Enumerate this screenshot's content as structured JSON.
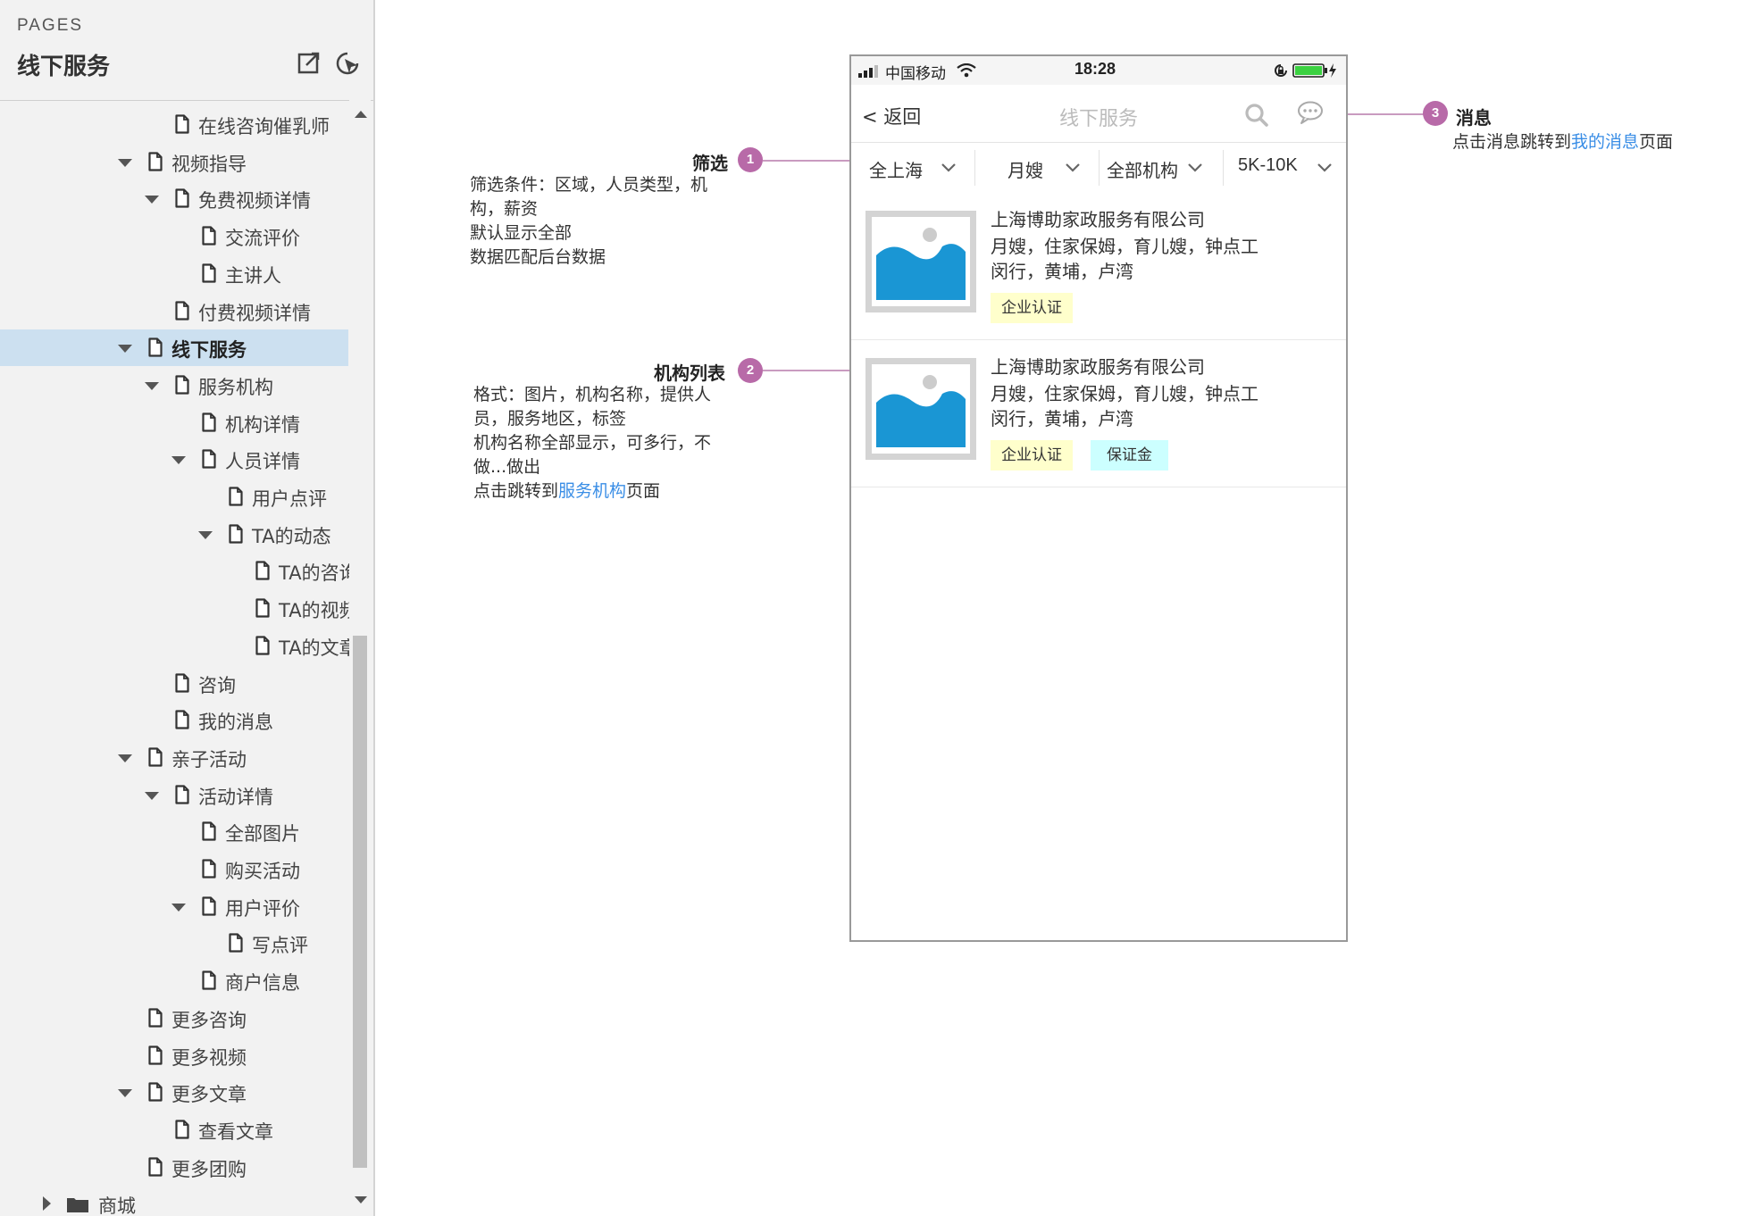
{
  "sidebar": {
    "header_label": "PAGES",
    "title": "线下服务",
    "tree": [
      {
        "label": "在线咨询催乳师",
        "level": 2,
        "toggle": "none",
        "icon": "page"
      },
      {
        "label": "视频指导",
        "level": 1,
        "toggle": "expanded",
        "icon": "page"
      },
      {
        "label": "免费视频详情",
        "level": 2,
        "toggle": "expanded",
        "icon": "page"
      },
      {
        "label": "交流评价",
        "level": 3,
        "toggle": "none",
        "icon": "page"
      },
      {
        "label": "主讲人",
        "level": 3,
        "toggle": "none",
        "icon": "page"
      },
      {
        "label": "付费视频详情",
        "level": 2,
        "toggle": "none",
        "icon": "page"
      },
      {
        "label": "线下服务",
        "level": 1,
        "toggle": "expanded",
        "icon": "page",
        "selected": true
      },
      {
        "label": "服务机构",
        "level": 2,
        "toggle": "expanded",
        "icon": "page"
      },
      {
        "label": "机构详情",
        "level": 3,
        "toggle": "none",
        "icon": "page"
      },
      {
        "label": "人员详情",
        "level": 3,
        "toggle": "expanded",
        "icon": "page"
      },
      {
        "label": "用户点评",
        "level": 4,
        "toggle": "none",
        "icon": "page"
      },
      {
        "label": "TA的动态",
        "level": 4,
        "toggle": "expanded",
        "icon": "page"
      },
      {
        "label": "TA的咨询",
        "level": 5,
        "toggle": "none",
        "icon": "page"
      },
      {
        "label": "TA的视频",
        "level": 5,
        "toggle": "none",
        "icon": "page"
      },
      {
        "label": "TA的文章",
        "level": 5,
        "toggle": "none",
        "icon": "page"
      },
      {
        "label": "咨询",
        "level": 2,
        "toggle": "none",
        "icon": "page"
      },
      {
        "label": "我的消息",
        "level": 2,
        "toggle": "none",
        "icon": "page"
      },
      {
        "label": "亲子活动",
        "level": 1,
        "toggle": "expanded",
        "icon": "page"
      },
      {
        "label": "活动详情",
        "level": 2,
        "toggle": "expanded",
        "icon": "page"
      },
      {
        "label": "全部图片",
        "level": 3,
        "toggle": "none",
        "icon": "page"
      },
      {
        "label": "购买活动",
        "level": 3,
        "toggle": "none",
        "icon": "page"
      },
      {
        "label": "用户评价",
        "level": 3,
        "toggle": "expanded",
        "icon": "page"
      },
      {
        "label": "写点评",
        "level": 4,
        "toggle": "none",
        "icon": "page"
      },
      {
        "label": "商户信息",
        "level": 3,
        "toggle": "none",
        "icon": "page"
      },
      {
        "label": "更多咨询",
        "level": 1,
        "toggle": "none",
        "icon": "page"
      },
      {
        "label": "更多视频",
        "level": 1,
        "toggle": "none",
        "icon": "page"
      },
      {
        "label": "更多文章",
        "level": 1,
        "toggle": "expanded",
        "icon": "page"
      },
      {
        "label": "查看文章",
        "level": 2,
        "toggle": "none",
        "icon": "page"
      },
      {
        "label": "更多团购",
        "level": 1,
        "toggle": "none",
        "icon": "page"
      },
      {
        "label": "商城",
        "level": 0,
        "toggle": "collapsed",
        "icon": "folder"
      }
    ]
  },
  "annotations": {
    "filter": {
      "number": "1",
      "title": "筛选",
      "lines": [
        "筛选条件：区域，人员类型，机",
        "构，薪资",
        "默认显示全部",
        "数据匹配后台数据"
      ]
    },
    "list": {
      "number": "2",
      "title": "机构列表",
      "lines": [
        "格式：图片，机构名称，提供人",
        "员，服务地区，标签",
        "机构名称全部显示，可多行，不",
        "做...做出"
      ],
      "link_prefix": "点击跳转到",
      "link_text": "服务机构",
      "link_suffix": "页面"
    },
    "message": {
      "number": "3",
      "title": "消息",
      "prefix": "点击消息跳转到",
      "link_text": "我的消息",
      "suffix": "页面"
    }
  },
  "phone": {
    "status": {
      "carrier": "中国移动",
      "time": "18:28"
    },
    "nav": {
      "back": "< 返回",
      "title": "线下服务"
    },
    "filters": [
      "全上海",
      "月嫂",
      "全部机构",
      "5K-10K"
    ],
    "items": [
      {
        "name": "上海博助家政服务有限公司",
        "types": "月嫂，住家保姆，育儿嫂，钟点工",
        "area": "闵行，黄埔，卢湾",
        "tags": [
          {
            "label": "企业认证",
            "color": "yellow"
          }
        ]
      },
      {
        "name": "上海博助家政服务有限公司",
        "types": "月嫂，住家保姆，育儿嫂，钟点工",
        "area": "闵行，黄埔，卢湾",
        "tags": [
          {
            "label": "企业认证",
            "color": "yellow"
          },
          {
            "label": "保证金",
            "color": "cyan"
          }
        ]
      }
    ]
  },
  "colors": {
    "accent_badge": "#b86aa8",
    "link": "#3a8ee6",
    "selected_row": "#cce0f0",
    "image_placeholder": "#1a96d4",
    "tag_yellow": "#ffffcc",
    "tag_cyan": "#ccffff"
  }
}
